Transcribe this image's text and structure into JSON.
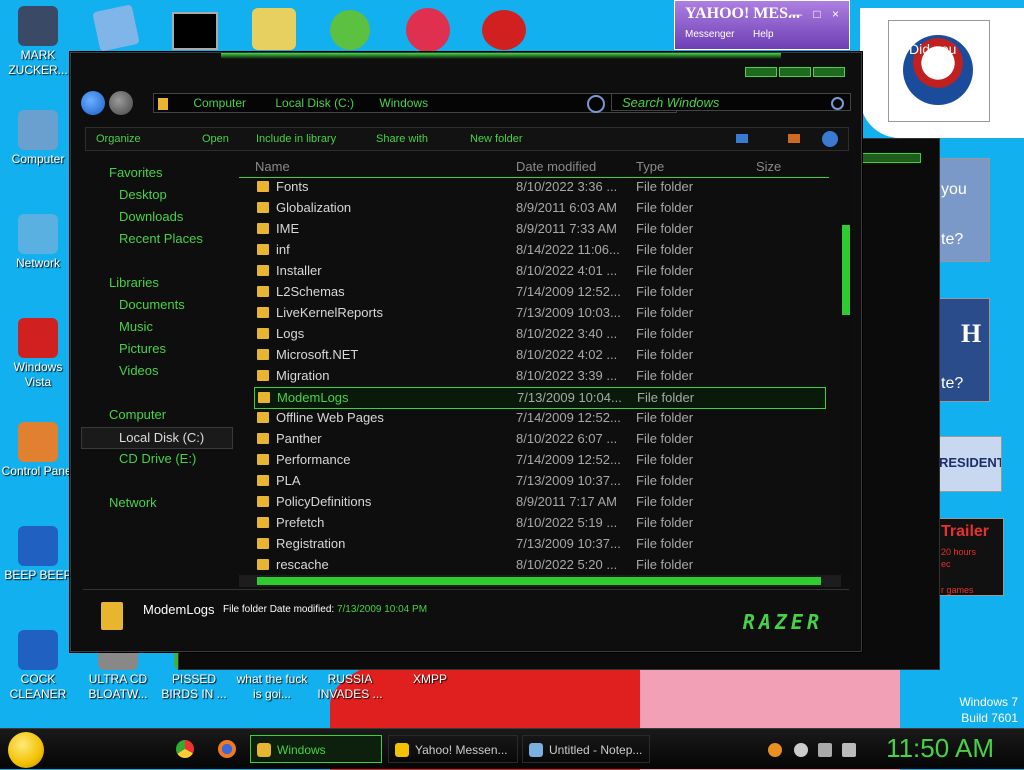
{
  "desktop": {
    "icons": [
      {
        "label": "MARK ZUCKER...",
        "color": "#3a4a66"
      },
      {
        "label": "Computer",
        "color": "#6aa0d0"
      },
      {
        "label": "Network",
        "color": "#5ab0e0"
      },
      {
        "label": "Windows Vista",
        "color": "#d02020"
      },
      {
        "label": "Control Panel",
        "color": "#e08030"
      },
      {
        "label": "BEEP BEEP",
        "color": "#2060c0"
      },
      {
        "label": "COCK CLEANER",
        "color": "#2060c0"
      },
      {
        "label": "ULTRA CD BLOATW...",
        "color": "#888888"
      },
      {
        "label": "PISSED BIRDS IN ...",
        "color": "#40b040"
      },
      {
        "label": "what the fuck is goi...",
        "color": "#e0a020"
      },
      {
        "label": "RUSSIA INVADES ...",
        "color": "#d02020"
      },
      {
        "label": "XMPP",
        "color": "#3080d0"
      }
    ],
    "version_line1": "Windows 7",
    "version_line2": "Build 7601"
  },
  "yahoo": {
    "title": "YAHOO! MES...",
    "menu1": "Messenger",
    "menu2": "Help",
    "controls": "— □ ×"
  },
  "ads": {
    "obama_text": "Did you",
    "ad2_text": "you",
    "ad2_sub": "te?",
    "ad3_sub": "te?",
    "ad4_text": "RESIDENT",
    "ad5_text": "Trailer",
    "ad5_sub": "20 hours",
    "ad5_sub2": "ec",
    "ad5_sub3": "r games"
  },
  "explorer": {
    "breadcrumb": [
      "Computer",
      "Local Disk (C:)",
      "Windows"
    ],
    "search_placeholder": "Search Windows",
    "toolbar": {
      "organize": "Organize",
      "open": "Open",
      "include": "Include in library",
      "share": "Share with",
      "new_folder": "New folder"
    },
    "columns": {
      "name": "Name",
      "date": "Date modified",
      "type": "Type",
      "size": "Size"
    },
    "nav": {
      "favorites": "Favorites",
      "desktop": "Desktop",
      "downloads": "Downloads",
      "recent": "Recent Places",
      "libraries": "Libraries",
      "documents": "Documents",
      "music": "Music",
      "pictures": "Pictures",
      "videos": "Videos",
      "computer": "Computer",
      "local_disk": "Local Disk (C:)",
      "cd_drive": "CD Drive (E:)",
      "network": "Network"
    },
    "files": [
      {
        "name": "Fonts",
        "date": "8/10/2022 3:36 ...",
        "type": "File folder"
      },
      {
        "name": "Globalization",
        "date": "8/9/2011 6:03 AM",
        "type": "File folder"
      },
      {
        "name": "IME",
        "date": "8/9/2011 7:33 AM",
        "type": "File folder"
      },
      {
        "name": "inf",
        "date": "8/14/2022 11:06...",
        "type": "File folder"
      },
      {
        "name": "Installer",
        "date": "8/10/2022 4:01 ...",
        "type": "File folder"
      },
      {
        "name": "L2Schemas",
        "date": "7/14/2009 12:52...",
        "type": "File folder"
      },
      {
        "name": "LiveKernelReports",
        "date": "7/13/2009 10:03...",
        "type": "File folder"
      },
      {
        "name": "Logs",
        "date": "8/10/2022 3:40 ...",
        "type": "File folder"
      },
      {
        "name": "Microsoft.NET",
        "date": "8/10/2022 4:02 ...",
        "type": "File folder"
      },
      {
        "name": "Migration",
        "date": "8/10/2022 3:39 ...",
        "type": "File folder"
      },
      {
        "name": "ModemLogs",
        "date": "7/13/2009 10:04...",
        "type": "File folder"
      },
      {
        "name": "Offline Web Pages",
        "date": "7/14/2009 12:52...",
        "type": "File folder"
      },
      {
        "name": "Panther",
        "date": "8/10/2022 6:07 ...",
        "type": "File folder"
      },
      {
        "name": "Performance",
        "date": "7/14/2009 12:52...",
        "type": "File folder"
      },
      {
        "name": "PLA",
        "date": "7/13/2009 10:37...",
        "type": "File folder"
      },
      {
        "name": "PolicyDefinitions",
        "date": "8/9/2011 7:17 AM",
        "type": "File folder"
      },
      {
        "name": "Prefetch",
        "date": "8/10/2022 5:19 ...",
        "type": "File folder"
      },
      {
        "name": "Registration",
        "date": "7/13/2009 10:37...",
        "type": "File folder"
      },
      {
        "name": "rescache",
        "date": "8/10/2022 5:20 ...",
        "type": "File folder"
      }
    ],
    "selected_index": 10,
    "details": {
      "name": "ModemLogs",
      "type_label": "File folder",
      "date_label": "Date modified:",
      "date_value": "7/13/2009 10:04 PM"
    },
    "brand": "RAZER"
  },
  "taskbar": {
    "items": [
      {
        "label": "Windows",
        "active": true,
        "color": "#e8b530"
      },
      {
        "label": "Yahoo! Messen...",
        "active": false,
        "color": "#f2c100"
      },
      {
        "label": "Untitled - Notep...",
        "active": false,
        "color": "#7ab0e0"
      }
    ],
    "clock": "11:50 AM"
  }
}
